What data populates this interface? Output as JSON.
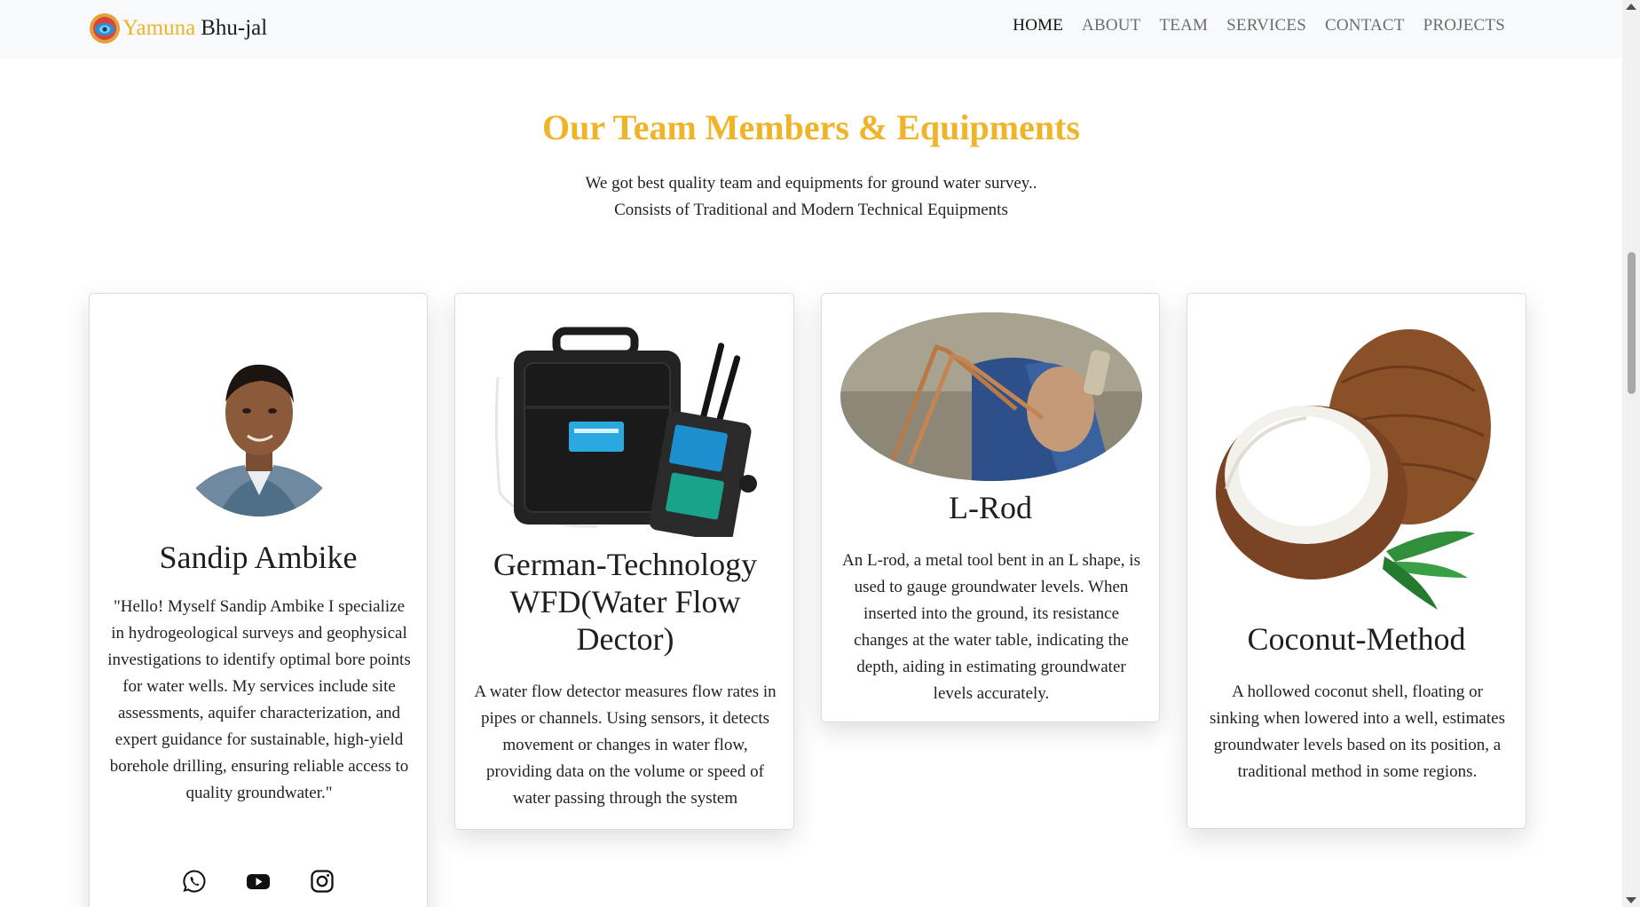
{
  "brand": {
    "name_part1": "Yamuna",
    "name_part2": "Bhu-jal"
  },
  "nav": {
    "items": [
      "HOME",
      "ABOUT",
      "TEAM",
      "SERVICES",
      "CONTACT",
      "PROJECTS"
    ],
    "active": "HOME"
  },
  "section": {
    "title": "Our Team Members & Equipments",
    "subtitle_line1": "We got best quality team and equipments for ground water survey..",
    "subtitle_line2": "Consists of Traditional and Modern Technical Equipments"
  },
  "cards": [
    {
      "title": "Sandip Ambike",
      "text": "\"Hello! Myself Sandip Ambike I specialize in hydrogeological surveys and geophysical investigations to identify optimal bore points for water wells. My services include site assessments, aquifer characterization, and expert guidance for sustainable, high-yield borehole drilling, ensuring reliable access to quality groundwater.\"",
      "image_icon": "person-photo",
      "social_icons": [
        "whatsapp-icon",
        "youtube-icon",
        "instagram-icon"
      ]
    },
    {
      "title": "German-Technology WFD(Water Flow Dector)",
      "text": "A water flow detector measures flow rates in pipes or channels. Using sensors, it detects movement or changes in water flow, providing data on the volume or speed of water passing through the system",
      "image_icon": "water-flow-detector-photo"
    },
    {
      "title": "L-Rod",
      "text": "An L-rod, a metal tool bent in an L shape, is used to gauge groundwater levels. When inserted into the ground, its resistance changes at the water table, indicating the depth, aiding in estimating groundwater levels accurately.",
      "image_icon": "l-rod-photo"
    },
    {
      "title": "Coconut-Method",
      "text": "A hollowed coconut shell, floating or sinking when lowered into a well, estimates groundwater levels based on its position, a traditional method in some regions.",
      "image_icon": "coconut-photo"
    }
  ],
  "colors": {
    "accent": "#f0b429",
    "navbar_bg": "#f8f9fa",
    "text": "#212529"
  }
}
